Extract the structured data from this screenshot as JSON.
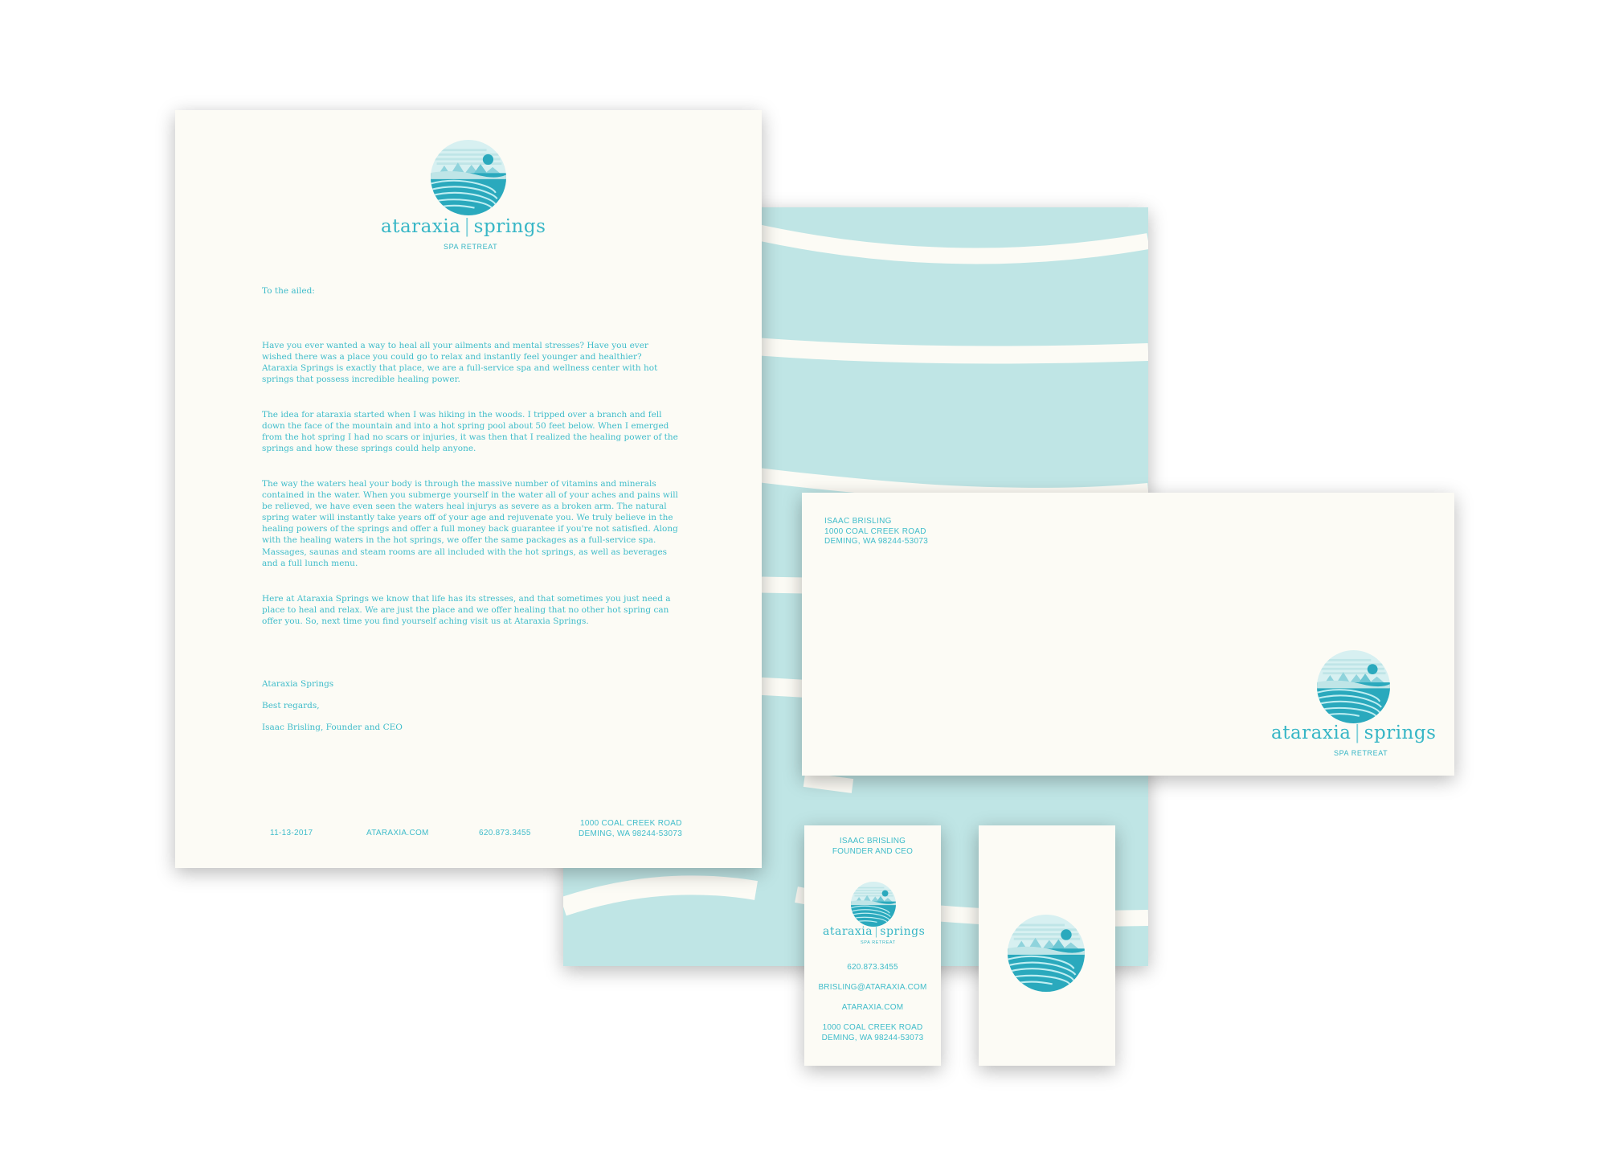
{
  "brand": {
    "name_part1": "ataraxia",
    "name_part2": "springs",
    "divider": "|",
    "tagline": "SPA RETREAT",
    "logo_icon": "ataraxia-springs-logo-icon",
    "colors": {
      "primary": "#2aa9bd",
      "light": "#bfe5e5",
      "paper": "#fcfbf5"
    }
  },
  "letter": {
    "salutation": "To the ailed:",
    "paragraphs": [
      "Have you ever wanted a way to heal all your ailments and mental stresses? Have you ever wished there was a place you could go to relax and instantly feel younger and healthier? Ataraxia Springs is exactly that place, we are a full-service spa and wellness center with hot springs that possess incredible healing power.",
      "The idea for ataraxia started when I was hiking in the woods. I tripped over a branch and fell down the face of the mountain and into a hot spring pool about 50 feet below. When I emerged from the hot spring I had no scars or injuries, it was then that I realized the healing power of the springs and how these springs could help anyone.",
      "The way the waters heal your body is through the massive number of vitamins and minerals contained in the water. When you submerge yourself in the water all of your aches and pains will be relieved, we have even seen the waters heal injurys as severe as a broken arm. The natural spring water will instantly take years off of your age and rejuvenate you. We truly believe in the healing powers of the springs and offer a full money back guarantee if you're not satisfied. Along with the healing waters in the hot springs, we offer the same packages as a full-service spa. Massages, saunas and steam rooms are all included with the hot springs, as well as beverages and a full lunch menu.",
      "Here at Ataraxia Springs we know that life has its stresses, and that sometimes you just need a place to heal and relax. We are just the place and we offer healing that no other hot spring can offer you. So, next time you find yourself aching visit us at Ataraxia Springs."
    ],
    "closing_org": "Ataraxia Springs",
    "closing": "Best regards,",
    "signer": "Isaac Brisling, Founder and CEO",
    "footer": {
      "date": "11-13-2017",
      "website": "ATARAXIA.COM",
      "phone": "620.873.3455",
      "address_line1": "1000 COAL CREEK ROAD",
      "address_line2": "DEMING, WA 98244-53073"
    }
  },
  "envelope": {
    "return_name": "ISAAC BRISLING",
    "return_line1": "1000 COAL CREEK ROAD",
    "return_line2": "DEMING, WA 98244-53073"
  },
  "card": {
    "name": "ISAAC BRISLING",
    "title": "FOUNDER AND CEO",
    "phone": "620.873.3455",
    "email": "BRISLING@ATARAXIA.COM",
    "website": "ATARAXIA.COM",
    "address_line1": "1000 COAL CREEK ROAD",
    "address_line2": "DEMING, WA 98244-53073"
  }
}
